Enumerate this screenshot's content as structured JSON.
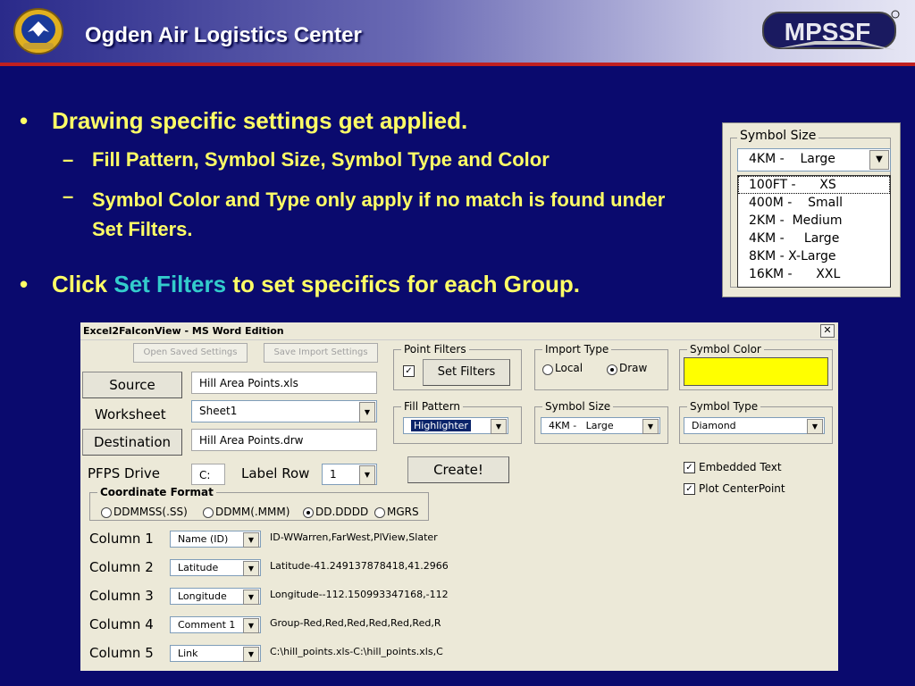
{
  "header": {
    "title": "Ogden Air Logistics Center",
    "logo_text": "MPSSF",
    "emblem_icon": "air-force-shield-icon"
  },
  "slide": {
    "bullet1": "Drawing specific settings get applied.",
    "sub1": "Fill Pattern, Symbol Size, Symbol Type and Color",
    "sub2": "Symbol Color and Type only apply if no match is found under Set Filters.",
    "bullet2_pre": "Click ",
    "bullet2_link": "Set Filters",
    "bullet2_post": " to set specifics for each Group.",
    "bullet_char": "•",
    "dash_char": "–"
  },
  "inset": {
    "legend": "Symbol Size",
    "selected": "4KM -    Large",
    "options": [
      "100FT -      XS",
      "400M -    Small",
      "2KM -  Medium",
      "4KM -     Large",
      "8KM - X-Large",
      "16KM -      XXL"
    ]
  },
  "dialog": {
    "title": "Excel2FalconView - MS Word Edition",
    "close": "✕",
    "open_saved": "Open Saved Settings",
    "save_import": "Save Import Settings",
    "source_btn": "Source",
    "source_value": "Hill Area Points.xls",
    "worksheet_label": "Worksheet",
    "worksheet_value": "Sheet1",
    "destination_btn": "Destination",
    "destination_value": "Hill Area Points.drw",
    "pfps_label": "PFPS Drive",
    "pfps_value": "C:",
    "label_row_label": "Label Row",
    "label_row_value": "1",
    "create_btn": "Create!",
    "point_filters": {
      "legend": "Point Filters",
      "checked": "✓",
      "button": "Set Filters"
    },
    "import_type": {
      "legend": "Import Type",
      "local": "Local",
      "draw": "Draw"
    },
    "symbol_color": {
      "legend": "Symbol Color",
      "color": "#ffff00"
    },
    "fill_pattern": {
      "legend": "Fill Pattern",
      "value": "Highlighter"
    },
    "symbol_size": {
      "legend": "Symbol Size",
      "value": "4KM -   Large"
    },
    "symbol_type": {
      "legend": "Symbol Type",
      "value": "Diamond"
    },
    "embedded_text": "Embedded Text",
    "plot_centerpoint": "Plot CenterPoint",
    "coordinate_format": {
      "legend": "Coordinate Format",
      "options": [
        "DDMMSS(.SS)",
        "DDMM(.MMM)",
        "DD.DDDD",
        "MGRS"
      ],
      "selected": "DD.DDDD"
    },
    "columns": [
      {
        "label": "Column 1",
        "field": "Name (ID)",
        "preview": "ID-WWarren,FarWest,PlView,Slater"
      },
      {
        "label": "Column 2",
        "field": "Latitude",
        "preview": "Latitude-41.249137878418,41.2966"
      },
      {
        "label": "Column 3",
        "field": "Longitude",
        "preview": "Longitude--112.150993347168,-112"
      },
      {
        "label": "Column 4",
        "field": "Comment 1",
        "preview": "Group-Red,Red,Red,Red,Red,Red,R"
      },
      {
        "label": "Column 5",
        "field": "Link",
        "preview": "C:\\hill_points.xls-C:\\hill_points.xls,C"
      }
    ]
  }
}
